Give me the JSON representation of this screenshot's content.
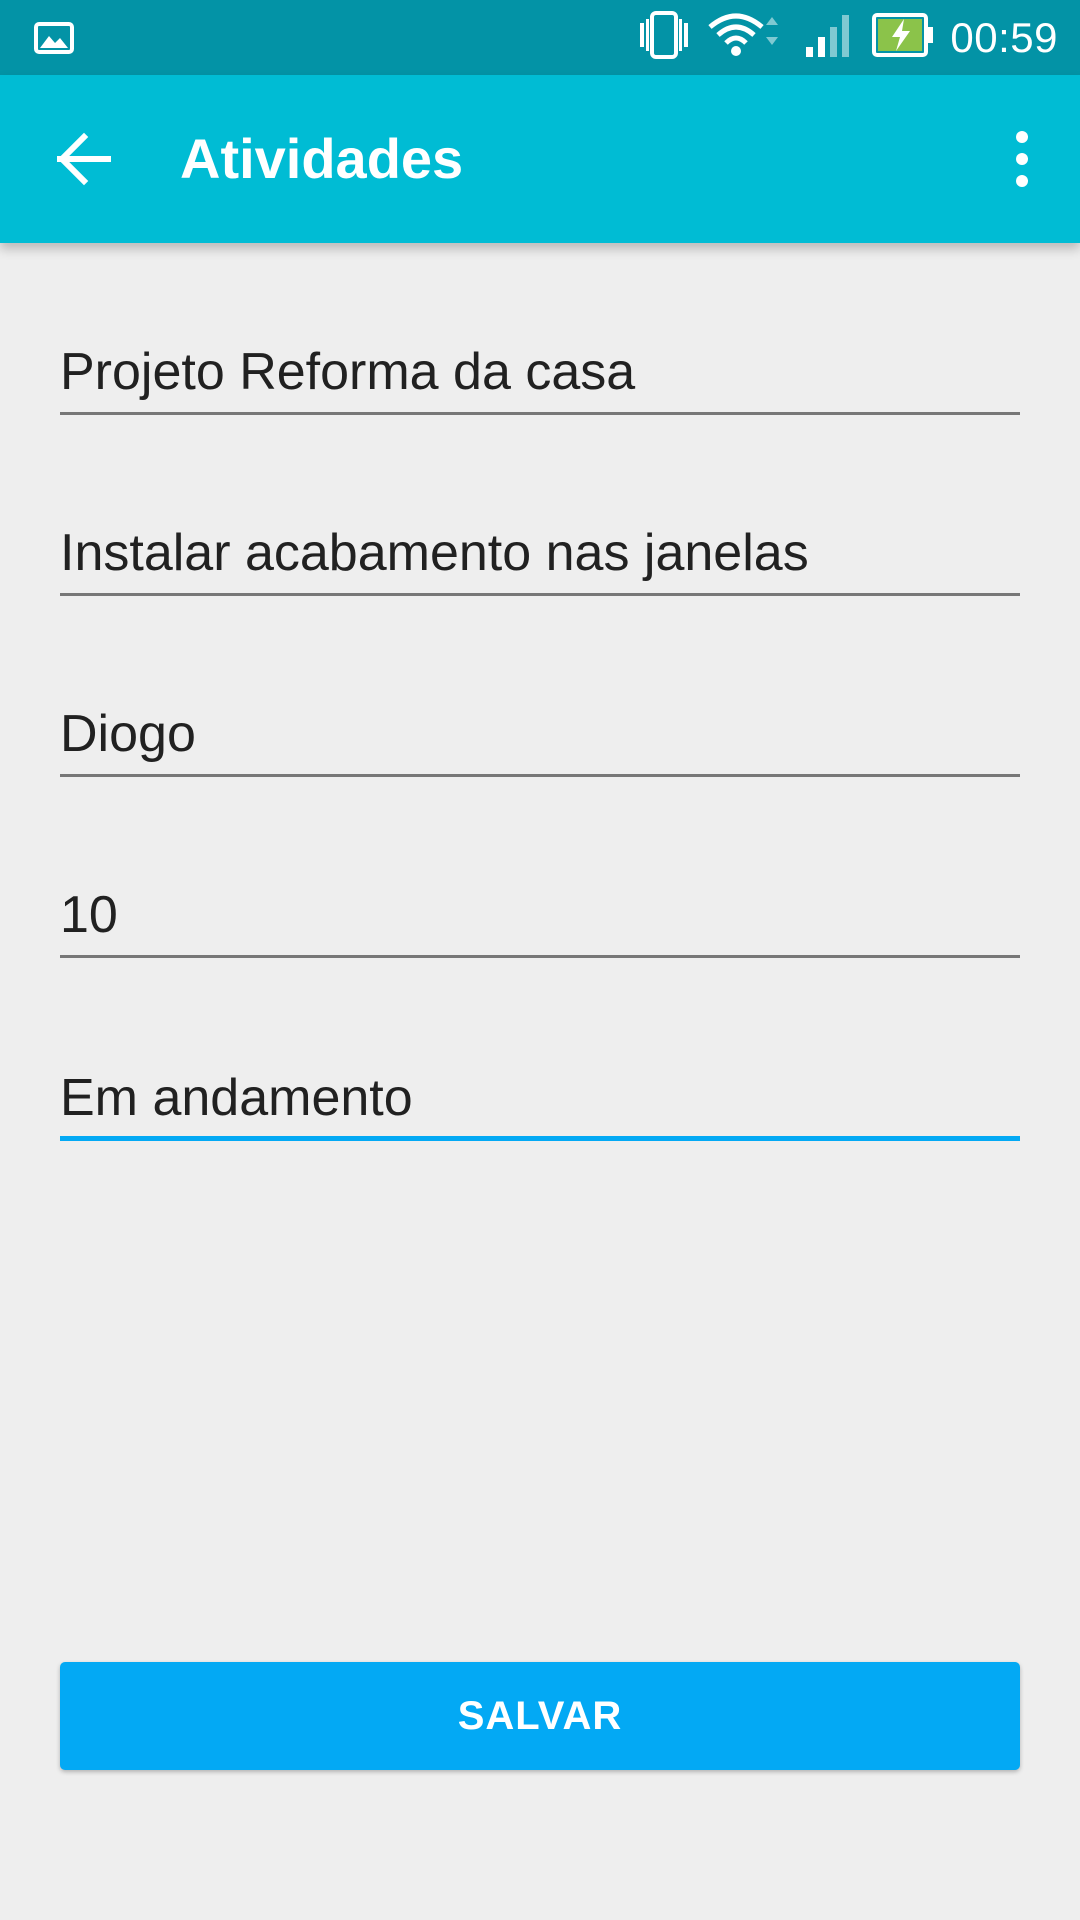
{
  "status_bar": {
    "time": "00:59",
    "icons": [
      "image-icon",
      "vibrate-icon",
      "wifi-icon",
      "signal-icon",
      "battery-charging-icon"
    ],
    "background": "#0393a6"
  },
  "app_bar": {
    "title": "Atividades",
    "background": "#00bcd4",
    "back_icon": "arrow-left-icon",
    "menu_icon": "more-vert-icon"
  },
  "form": {
    "fields": [
      {
        "value": "Projeto Reforma da casa",
        "focused": false
      },
      {
        "value": "Instalar acabamento nas janelas",
        "focused": false
      },
      {
        "value": "Diogo",
        "focused": false
      },
      {
        "value": "10",
        "focused": false
      },
      {
        "value": "Em andamento",
        "focused": true
      }
    ]
  },
  "save_button": {
    "label": "SALVAR",
    "color": "#03a9f4"
  }
}
